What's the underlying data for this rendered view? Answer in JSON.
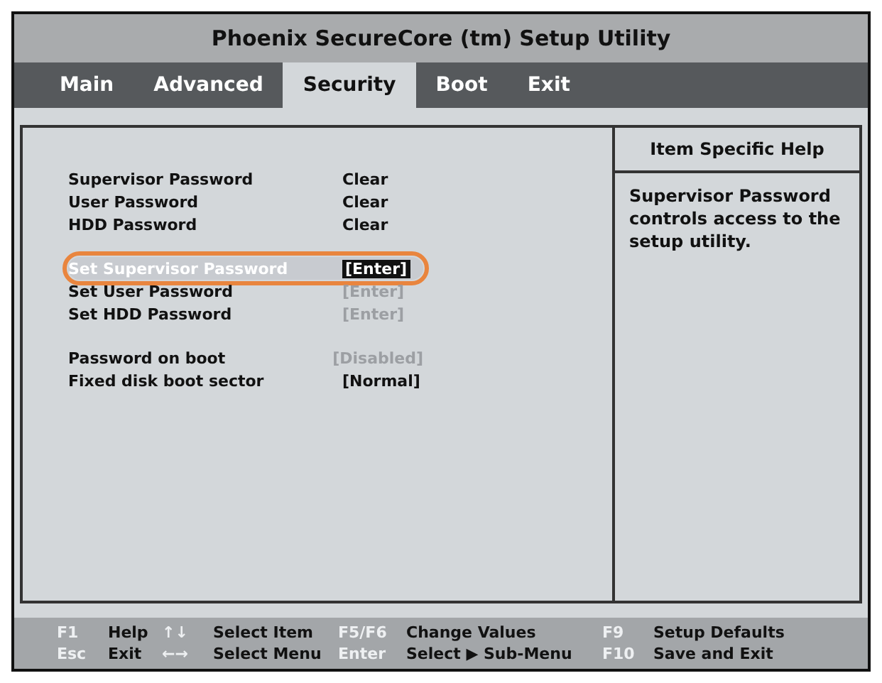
{
  "window": {
    "title": "Phoenix SecureCore (tm) Setup Utility"
  },
  "tabs": [
    {
      "label": "Main",
      "selected": false
    },
    {
      "label": "Advanced",
      "selected": false
    },
    {
      "label": "Security",
      "selected": true
    },
    {
      "label": "Boot",
      "selected": false
    },
    {
      "label": "Exit",
      "selected": false
    }
  ],
  "settings": [
    {
      "rows": [
        {
          "label": "Supervisor Password",
          "value": "Clear",
          "selected": false,
          "disabled": false
        },
        {
          "label": "User Password",
          "value": "Clear",
          "selected": false,
          "disabled": false
        },
        {
          "label": "HDD Password",
          "value": "Clear",
          "selected": false,
          "disabled": false
        }
      ]
    },
    {
      "rows": [
        {
          "label": "Set Supervisor Password",
          "value": "[Enter]",
          "selected": true,
          "disabled": false
        },
        {
          "label": "Set User Password",
          "value": "[Enter]",
          "selected": false,
          "disabled": true
        },
        {
          "label": "Set HDD Password",
          "value": "[Enter]",
          "selected": false,
          "disabled": true
        }
      ]
    },
    {
      "rows": [
        {
          "label": "Password on boot",
          "value": "[Disabled]",
          "selected": false,
          "disabled": true
        },
        {
          "label": "Fixed disk boot sector",
          "value": "[Normal]",
          "selected": false,
          "disabled": false
        }
      ]
    }
  ],
  "help": {
    "title": "Item Specific Help",
    "text": "Supervisor Password controls access to the setup utility."
  },
  "status_bar": [
    [
      {
        "key": "F1",
        "action": "Help"
      },
      {
        "key": "↑↓",
        "action": "Select Item"
      },
      {
        "key": "F5/F6",
        "action": "Change Values"
      },
      {
        "key": "F9",
        "action": "Setup Defaults"
      }
    ],
    [
      {
        "key": "Esc",
        "action": "Exit"
      },
      {
        "key": "←→",
        "action": "Select Menu"
      },
      {
        "key": "Enter",
        "action": "Select ▶ Sub-Menu"
      },
      {
        "key": "F10",
        "action": "Save and Exit"
      }
    ]
  ]
}
